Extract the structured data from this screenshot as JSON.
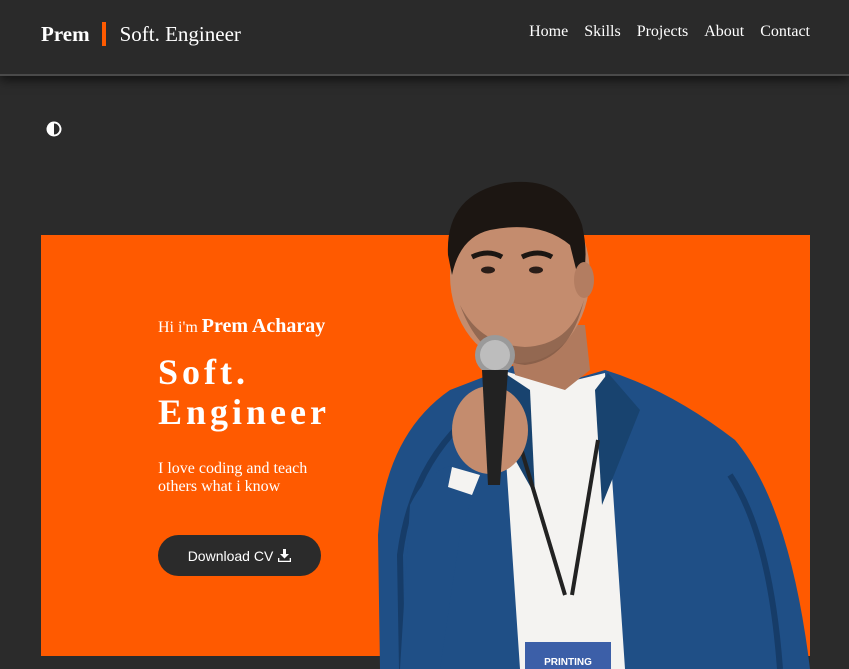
{
  "header": {
    "brand_name": "Prem",
    "brand_role": "Soft. Engineer",
    "nav": [
      {
        "label": "Home"
      },
      {
        "label": "Skills"
      },
      {
        "label": "Projects"
      },
      {
        "label": "About"
      },
      {
        "label": "Contact"
      }
    ]
  },
  "theme_toggle": {
    "icon": "half-circle-contrast-icon"
  },
  "hero": {
    "greeting_prefix": "Hi i'm",
    "greeting_name": "Prem Acharay",
    "title_line1": "Soft.",
    "title_line2": "Engineer",
    "tagline": "I love coding and teach others what i know",
    "cv_button_label": "Download CV",
    "cv_button_icon": "download-icon",
    "badge_text": "PRINTING"
  },
  "colors": {
    "accent": "#ff5a00",
    "background": "#2b2b2b",
    "text": "#ffffff"
  }
}
